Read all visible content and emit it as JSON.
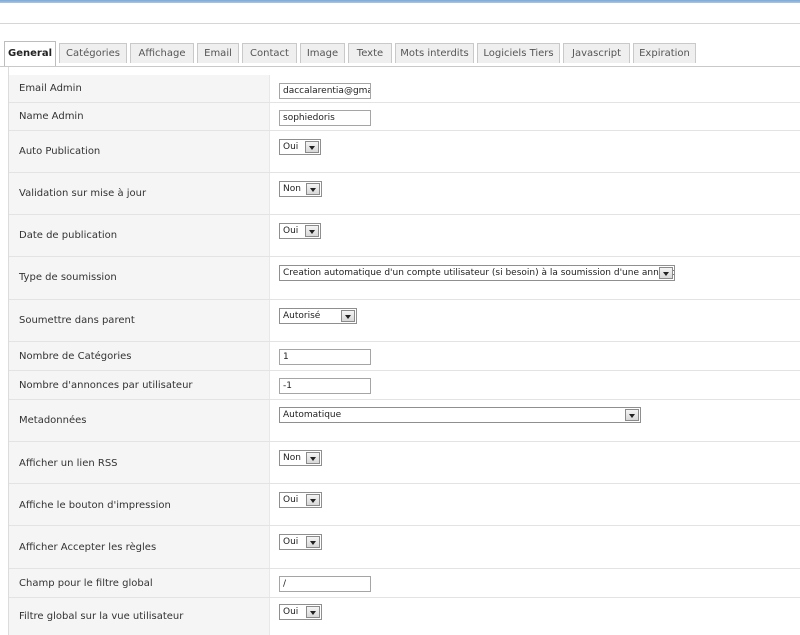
{
  "tabs": [
    {
      "label": "General",
      "active": true
    },
    {
      "label": "Catégories"
    },
    {
      "label": "Affichage"
    },
    {
      "label": "Email"
    },
    {
      "label": "Contact"
    },
    {
      "label": "Image"
    },
    {
      "label": "Texte"
    },
    {
      "label": "Mots interdits"
    },
    {
      "label": "Logiciels Tiers"
    },
    {
      "label": "Javascript"
    },
    {
      "label": "Expiration"
    }
  ],
  "fields": [
    {
      "label": "Email Admin",
      "type": "text",
      "value": "daccalarentia@gmail"
    },
    {
      "label": "Name Admin",
      "type": "text",
      "value": "sophiedoris"
    },
    {
      "label": "Auto Publication",
      "type": "select",
      "value": "Oui"
    },
    {
      "label": "Validation sur mise à jour",
      "type": "select",
      "value": "Non"
    },
    {
      "label": "Date de publication",
      "type": "select",
      "value": "Oui"
    },
    {
      "label": "Type de soumission",
      "type": "select",
      "value": "Creation automatique d'un compte utilisateur (si besoin) à la soumission d'une annonce"
    },
    {
      "label": "Soumettre dans parent",
      "type": "select",
      "value": "Autorisé"
    },
    {
      "label": "Nombre de Catégories",
      "type": "text",
      "value": "1"
    },
    {
      "label": "Nombre d'annonces par utilisateur",
      "type": "text",
      "value": "-1"
    },
    {
      "label": "Metadonnées",
      "type": "select",
      "value": "Automatique"
    },
    {
      "label": "Afficher un lien RSS",
      "type": "select",
      "value": "Non"
    },
    {
      "label": "Affiche le bouton d'impression",
      "type": "select",
      "value": "Oui"
    },
    {
      "label": "Afficher Accepter les règles",
      "type": "select",
      "value": "Oui"
    },
    {
      "label": "Champ pour le filtre global",
      "type": "text",
      "value": "/"
    },
    {
      "label": "Filtre global sur la vue utilisateur",
      "type": "select",
      "value": "Oui"
    }
  ]
}
